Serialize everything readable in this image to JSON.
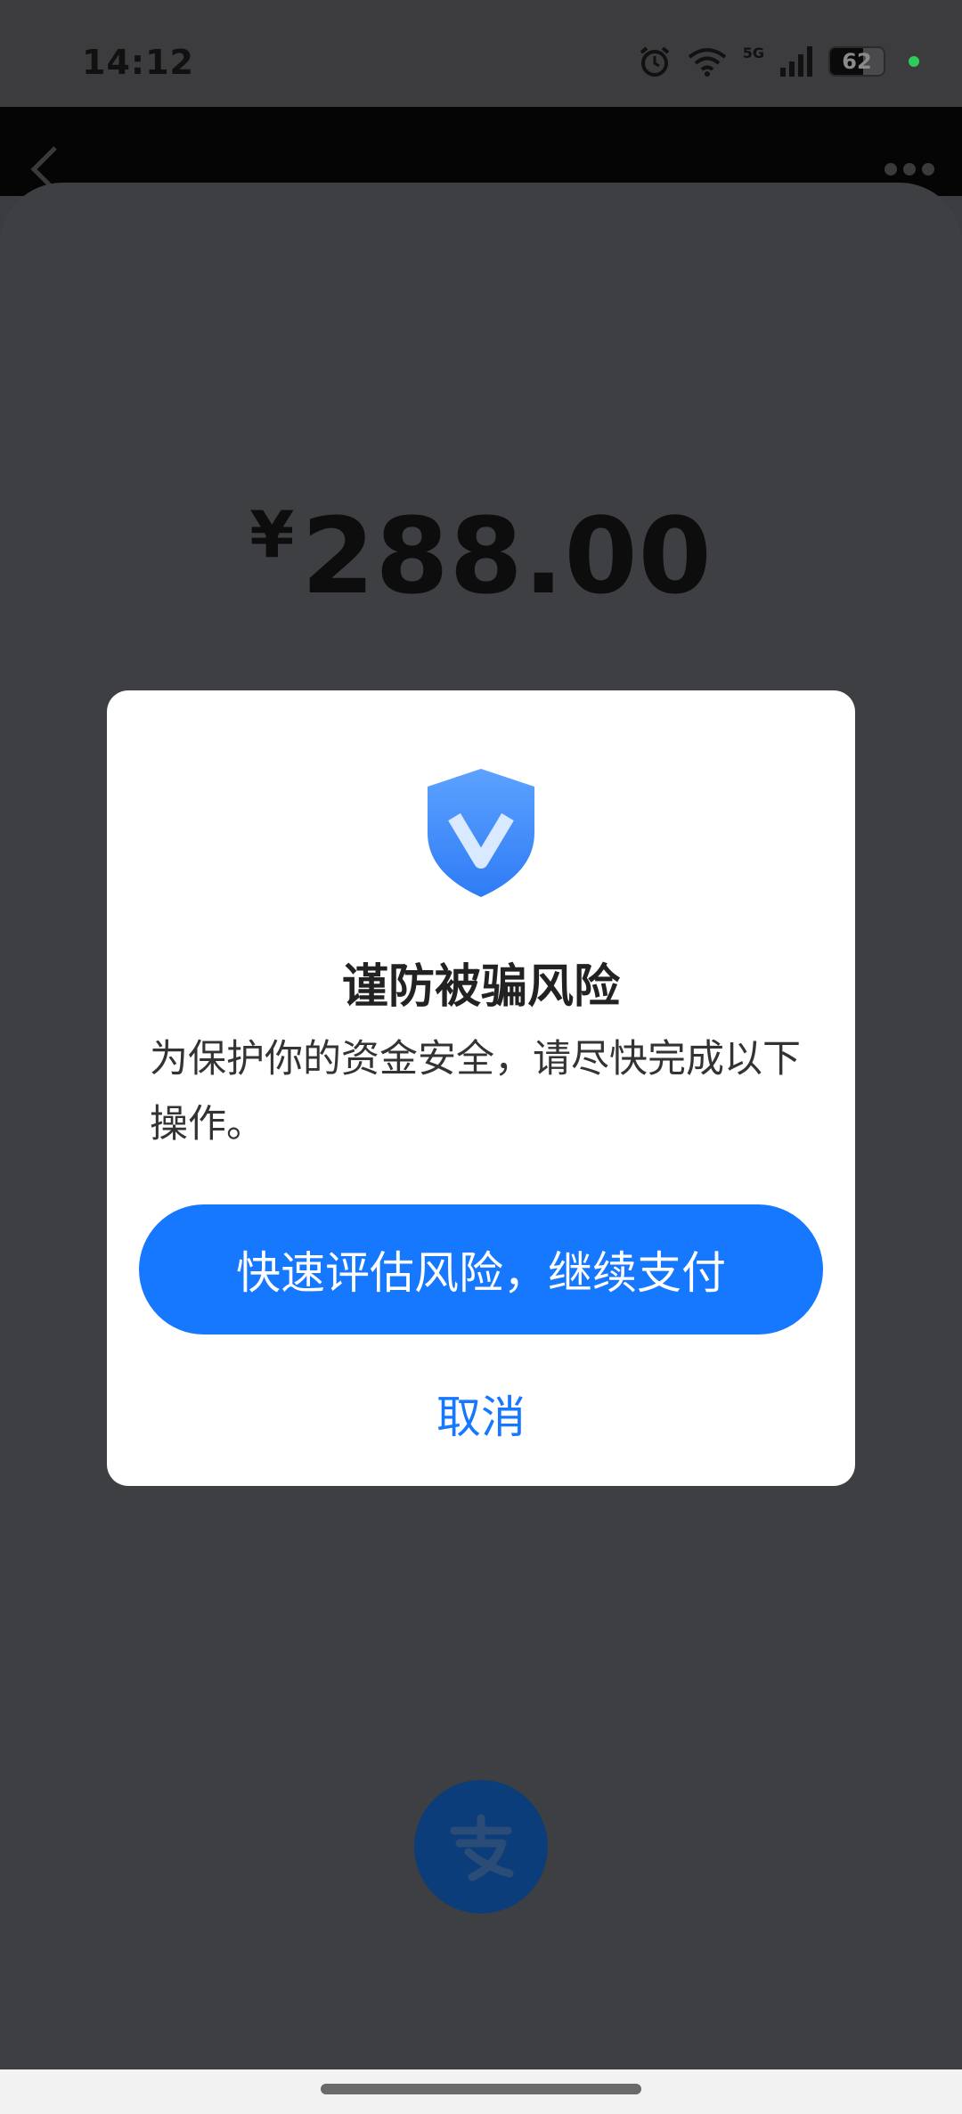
{
  "status_bar": {
    "time": "14:12",
    "network": "5G",
    "battery": "62",
    "battery_level": 0.62
  },
  "payment": {
    "currency": "¥",
    "amount": "288.00"
  },
  "dialog": {
    "title": "谨防被骗风险",
    "message": "为保护你的资金安全，请尽快完成以下操作。",
    "primary_label": "快速评估风险，继续支付",
    "cancel_label": "取消"
  },
  "colors": {
    "accent": "#1677ff",
    "overlay": "#3e3f42",
    "alipay_logo": "#0b3d7a"
  },
  "icons": {
    "back": "chevron-left-icon",
    "more": "more-dots-icon",
    "shield": "shield-check-icon",
    "logo": "alipay-logo-icon"
  }
}
